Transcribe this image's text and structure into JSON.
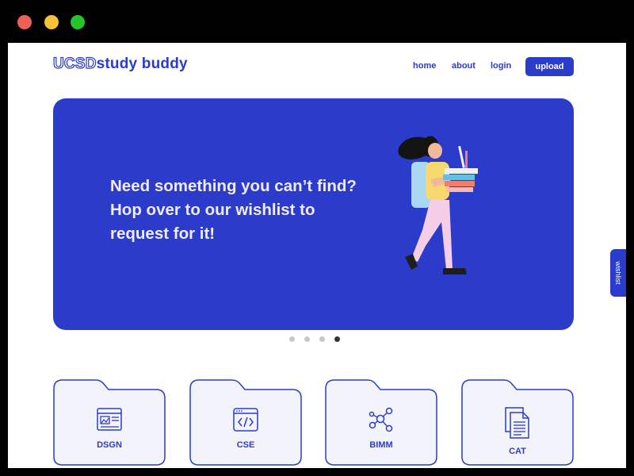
{
  "window": {
    "controls": [
      "close",
      "minimize",
      "maximize"
    ]
  },
  "header": {
    "brand_prefix": "UCSD",
    "brand_suffix": "study buddy",
    "nav": {
      "home": "home",
      "about": "about",
      "login": "login"
    },
    "upload_label": "upload"
  },
  "hero": {
    "lines": [
      "Need something you can’t find?",
      "Hop over to our wishlist to",
      "request for it!"
    ],
    "prev_icon": "arrow-left-icon",
    "next_icon": "arrow-right-icon"
  },
  "carousel": {
    "slide_count": 4,
    "active_index": 3
  },
  "wishlist_tab": {
    "label": "wishlist"
  },
  "categories": [
    {
      "label": "DSGN",
      "icon": "design-layout-icon"
    },
    {
      "label": "CSE",
      "icon": "code-window-icon"
    },
    {
      "label": "BIMM",
      "icon": "molecule-network-icon"
    },
    {
      "label": "CAT",
      "icon": "documents-icon"
    }
  ],
  "colors": {
    "primary": "#2b3cca",
    "hero_text": "#f0ebff",
    "folder_fill": "#f3f3fb",
    "arrow": "#8b2626",
    "dot_inactive": "#c7c7c7",
    "dot_active": "#333333"
  }
}
